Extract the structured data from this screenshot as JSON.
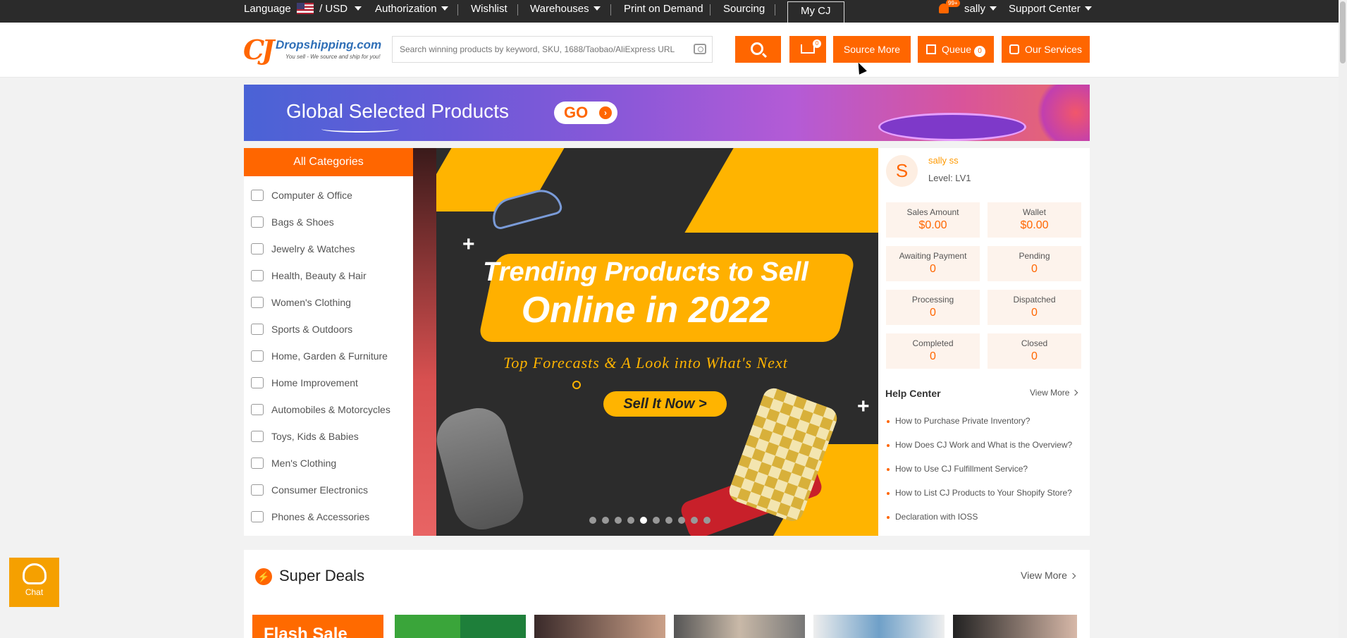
{
  "topbar": {
    "language": "Language",
    "currency": "/ USD",
    "authorization": "Authorization",
    "wishlist": "Wishlist",
    "warehouses": "Warehouses",
    "print_on_demand": "Print on Demand",
    "sourcing": "Sourcing",
    "my_cj": "My CJ",
    "notification_badge": "99+",
    "user": "sally",
    "support": "Support Center"
  },
  "header": {
    "logo_mark": "CJ",
    "logo_text": "Dropshipping.com",
    "logo_tagline": "You sell - We source and ship for you!",
    "search_placeholder": "Search winning products by keyword, SKU, 1688/Taobao/AliExpress URL",
    "cart_badge": "0",
    "source_more": "Source More",
    "queue": "Queue",
    "queue_badge": "0",
    "our_services": "Our Services",
    "accent_color": "#ff6600"
  },
  "banner": {
    "title": "Global Selected Products",
    "go": "GO",
    "go_arrow": "›"
  },
  "categories": {
    "title": "All Categories",
    "items": [
      {
        "label": "Computer & Office",
        "icon": "computer-icon"
      },
      {
        "label": "Bags & Shoes",
        "icon": "bag-icon"
      },
      {
        "label": "Jewelry & Watches",
        "icon": "watch-icon"
      },
      {
        "label": "Health, Beauty & Hair",
        "icon": "brush-icon"
      },
      {
        "label": "Women's Clothing",
        "icon": "dress-icon"
      },
      {
        "label": "Sports & Outdoors",
        "icon": "shoe-icon"
      },
      {
        "label": "Home, Garden & Furniture",
        "icon": "sofa-icon"
      },
      {
        "label": "Home Improvement",
        "icon": "hammer-icon"
      },
      {
        "label": "Automobiles & Motorcycles",
        "icon": "motorcycle-icon"
      },
      {
        "label": "Toys, Kids & Babies",
        "icon": "toy-icon"
      },
      {
        "label": "Men's Clothing",
        "icon": "shirt-icon"
      },
      {
        "label": "Consumer Electronics",
        "icon": "headphones-icon"
      },
      {
        "label": "Phones & Accessories",
        "icon": "phone-icon"
      }
    ]
  },
  "hero": {
    "line1": "Trending Products to Sell",
    "line2": "Online in 2022",
    "subtitle": "Top Forecasts & A Look into What's Next",
    "cta": "Sell It Now >",
    "slide_count": 10,
    "active_slide": 5
  },
  "account": {
    "avatar_letter": "S",
    "name": "sally ss",
    "level": "Level: LV1",
    "stats": [
      {
        "label": "Sales Amount",
        "value": "$0.00"
      },
      {
        "label": "Wallet",
        "value": "$0.00"
      },
      {
        "label": "Awaiting Payment",
        "value": "0"
      },
      {
        "label": "Pending",
        "value": "0"
      },
      {
        "label": "Processing",
        "value": "0"
      },
      {
        "label": "Dispatched",
        "value": "0"
      },
      {
        "label": "Completed",
        "value": "0"
      },
      {
        "label": "Closed",
        "value": "0"
      }
    ],
    "help_title": "Help Center",
    "help_more": "View More",
    "help_links": [
      "How to Purchase Private Inventory?",
      "How Does CJ Work and What is the Overview?",
      "How to Use CJ Fulfillment Service?",
      "How to List CJ Products to Your Shopify Store?",
      "Declaration with IOSS"
    ]
  },
  "deals": {
    "title": "Super Deals",
    "view_more": "View More",
    "first_thumb_text": "Flash Sale"
  },
  "chat": {
    "label": "Chat"
  }
}
